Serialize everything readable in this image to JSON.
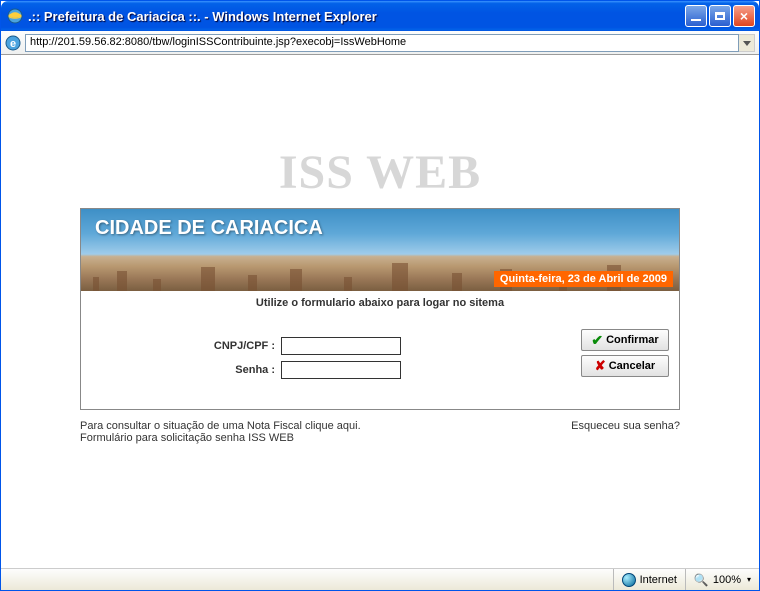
{
  "window": {
    "title": ".:: Prefeitura de Cariacica ::. - Windows Internet Explorer",
    "url": "http://201.59.56.82:8080/tbw/loginISSContribuinte.jsp?execobj=IssWebHome"
  },
  "page": {
    "logo_text": "ISS WEB",
    "banner_title": "CIDADE DE CARIACICA",
    "date_badge": "Quinta-feira, 23 de Abril de 2009",
    "instruction": "Utilize o formulario abaixo para logar no sitema",
    "fields": {
      "cnpj_label": "CNPJ/CPF :",
      "cnpj_value": "",
      "senha_label": "Senha :",
      "senha_value": ""
    },
    "buttons": {
      "confirm": "Confirmar",
      "cancel": "Cancelar"
    },
    "links": {
      "consult_nota": "Para consultar o situação de uma Nota Fiscal clique aqui.",
      "form_senha": "Formulário para solicitação senha ISS WEB",
      "forgot": "Esqueceu sua senha?"
    }
  },
  "statusbar": {
    "zone": "Internet",
    "zoom": "100%"
  }
}
